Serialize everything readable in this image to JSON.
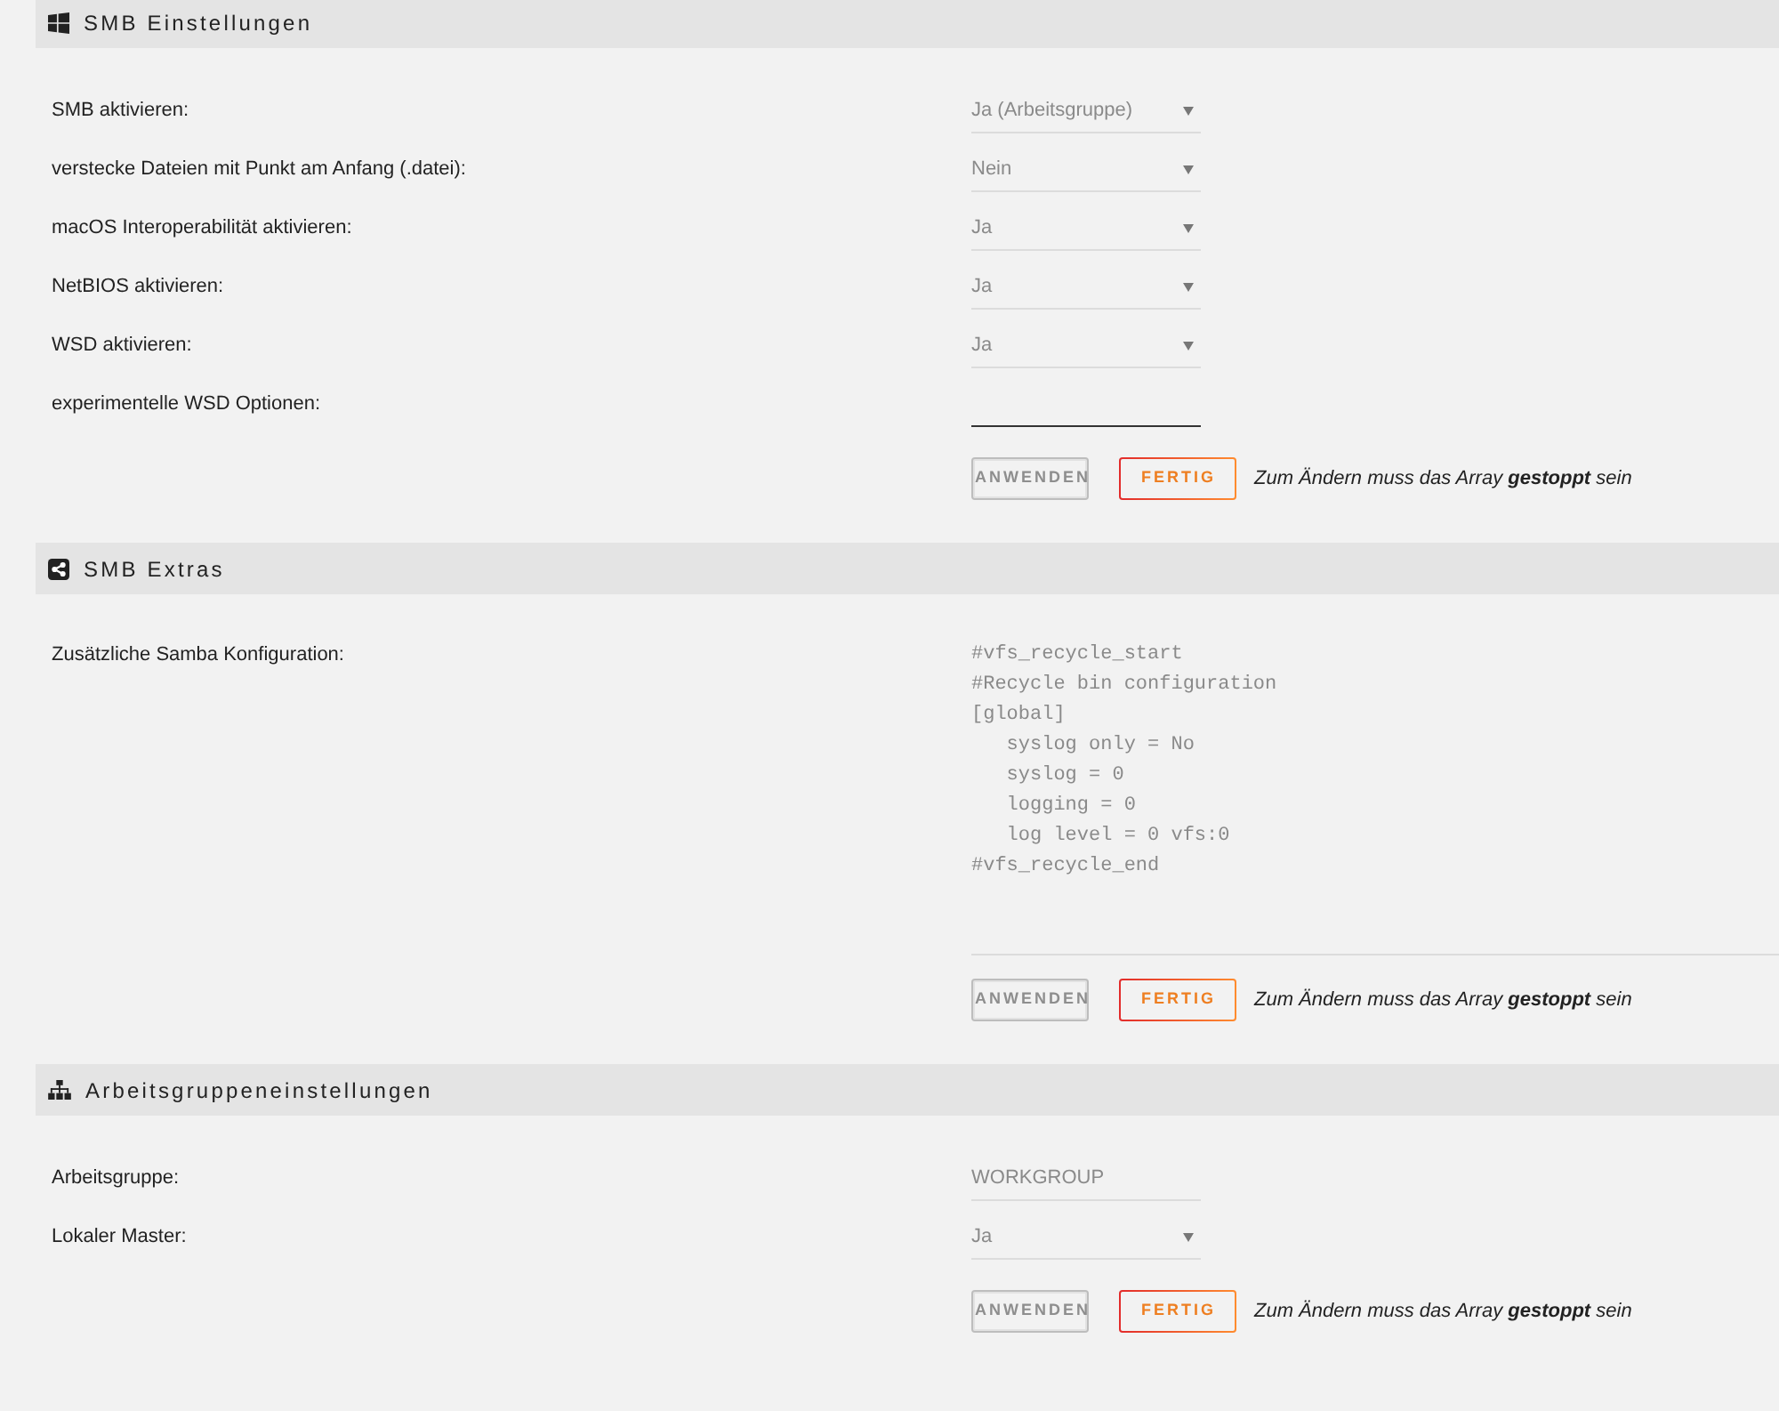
{
  "sections": [
    {
      "title": "SMB Einstellungen",
      "fields": [
        {
          "kind": "select",
          "label": "SMB aktivieren:",
          "value": "Ja (Arbeitsgruppe)"
        },
        {
          "kind": "select",
          "label": "verstecke Dateien mit Punkt am Anfang (.datei):",
          "value": "Nein"
        },
        {
          "kind": "select",
          "label": "macOS Interoperabilität aktivieren:",
          "value": "Ja"
        },
        {
          "kind": "select",
          "label": "NetBIOS aktivieren:",
          "value": "Ja"
        },
        {
          "kind": "select",
          "label": "WSD aktivieren:",
          "value": "Ja"
        },
        {
          "kind": "input",
          "label": "experimentelle WSD Optionen:",
          "focused": true
        }
      ],
      "buttons": [
        {
          "label": "ANWENDEN",
          "disabled": true
        },
        {
          "label": "FERTIG",
          "disabled": false
        }
      ],
      "note": "Zum Ändern muss das Array **gestoppt** sein"
    },
    {
      "title": "SMB Extras",
      "fields": [
        {
          "kind": "textarea",
          "label": "Zusätzliche Samba Konfiguration:",
          "value": "#vfs_recycle_start\n#Recycle bin configuration\n[global]\n   syslog only = No\n   syslog = 0\n   logging = 0\n   log level = 0 vfs:0\n#vfs_recycle_end"
        }
      ],
      "buttons": [
        {
          "label": "ANWENDEN",
          "disabled": true
        },
        {
          "label": "FERTIG",
          "disabled": false
        }
      ],
      "note": "Zum Ändern muss das Array **gestoppt** sein"
    },
    {
      "title": "Arbeitsgruppeneinstellungen",
      "fields": [
        {
          "kind": "input",
          "label": "Arbeitsgruppe:",
          "value": "WORKGROUP",
          "focused": false
        },
        {
          "kind": "select",
          "label": "Lokaler Master:",
          "value": "Ja"
        }
      ],
      "buttons": [
        {
          "label": "ANWENDEN",
          "disabled": true
        },
        {
          "label": "FERTIG",
          "disabled": false
        }
      ],
      "note": "Zum Ändern muss das Array **gestoppt** sein"
    }
  ]
}
